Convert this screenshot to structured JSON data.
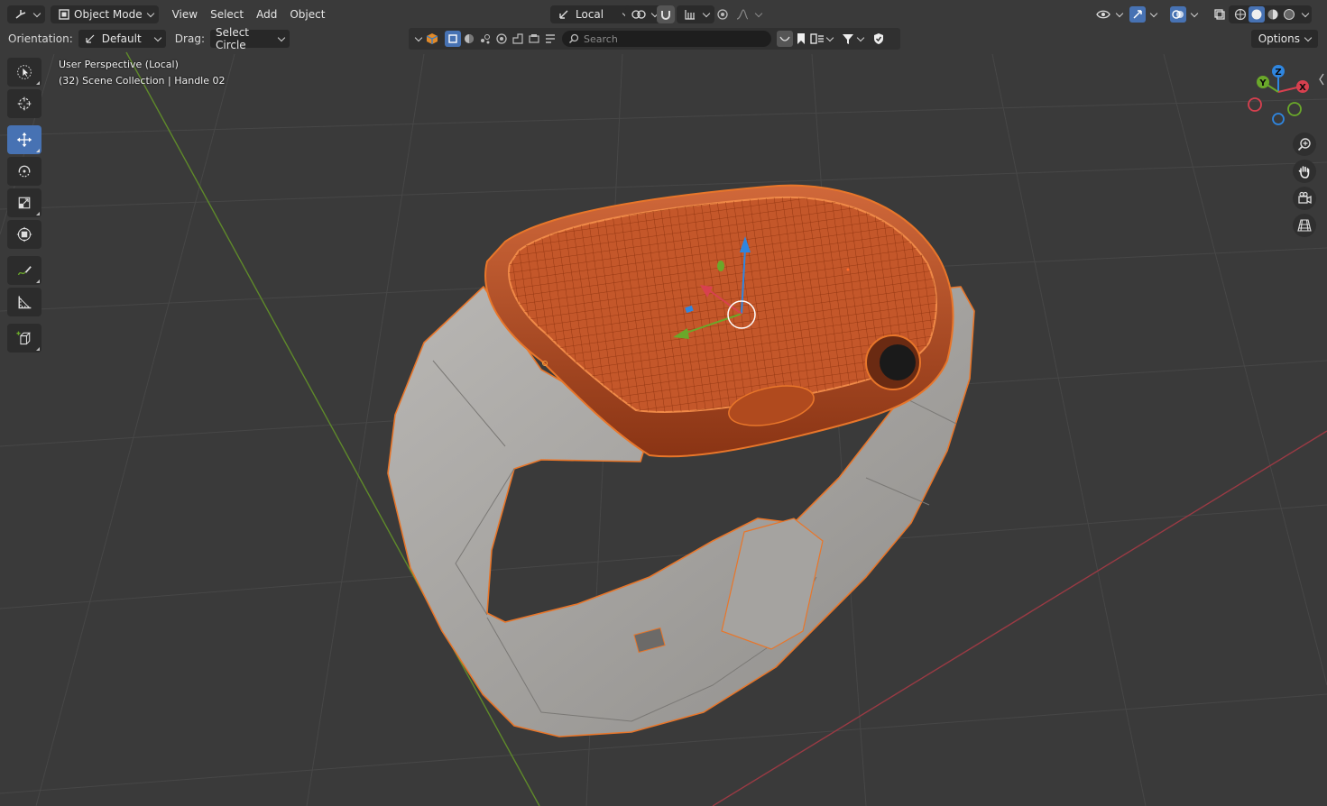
{
  "header": {
    "mode_label": "Object Mode",
    "menus": [
      "View",
      "Select",
      "Add",
      "Object"
    ],
    "transform_orientation": "Local"
  },
  "tool_settings": {
    "orientation_label": "Orientation:",
    "orientation_value": "Default",
    "drag_label": "Drag:",
    "drag_value": "Select Circle",
    "options_label": "Options"
  },
  "outliner": {
    "search_placeholder": "Search"
  },
  "viewport": {
    "view_name": "User Perspective (Local)",
    "collection_info": "(32) Scene Collection | Handle 02"
  },
  "gizmo": {
    "x_label": "X",
    "y_label": "Y",
    "z_label": "Z"
  },
  "colors": {
    "selection_orange": "#e8762a",
    "active_tool": "#4772b3",
    "axis_x": "#d8404f",
    "axis_y": "#6aa82a",
    "axis_z": "#2f86e0"
  }
}
